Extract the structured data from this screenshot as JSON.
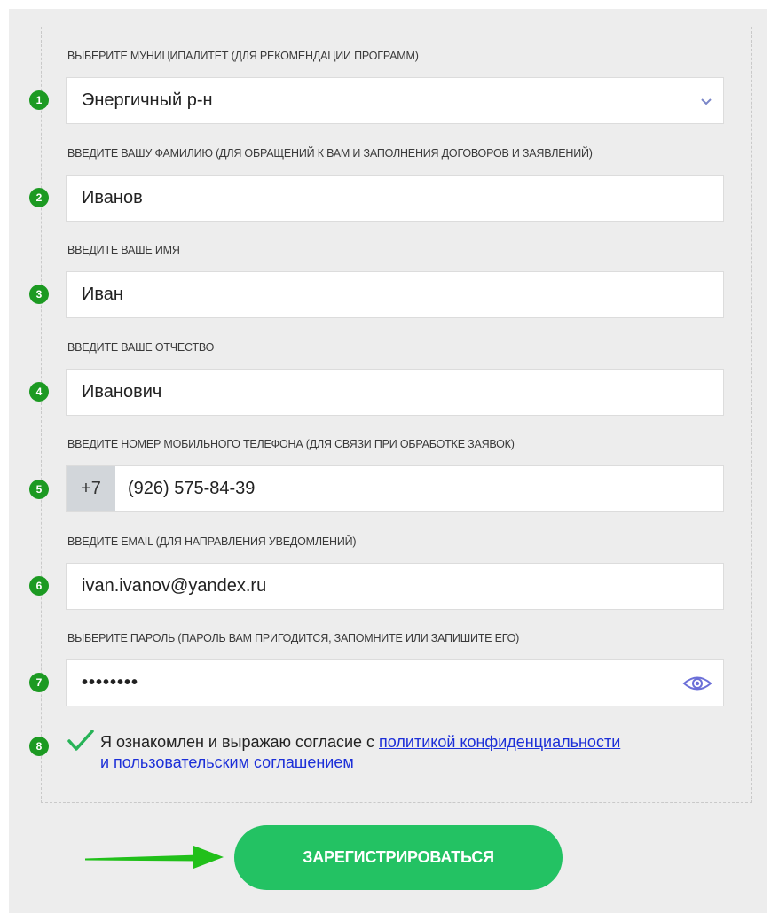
{
  "form": {
    "fields": [
      {
        "number": "1",
        "label": "ВЫБЕРИТЕ МУНИЦИПАЛИТЕТ (ДЛЯ РЕКОМЕНДАЦИИ ПРОГРАММ)",
        "value": "Энергичный р-н",
        "type": "select"
      },
      {
        "number": "2",
        "label": "ВВЕДИТЕ ВАШУ ФАМИЛИЮ (ДЛЯ ОБРАЩЕНИЙ К ВАМ И ЗАПОЛНЕНИЯ ДОГОВОРОВ И ЗАЯВЛЕНИЙ)",
        "value": "Иванов",
        "type": "text"
      },
      {
        "number": "3",
        "label": "ВВЕДИТЕ ВАШЕ ИМЯ",
        "value": "Иван",
        "type": "text"
      },
      {
        "number": "4",
        "label": "ВВЕДИТЕ ВАШЕ ОТЧЕСТВО",
        "value": "Иванович",
        "type": "text"
      },
      {
        "number": "5",
        "label": "ВВЕДИТЕ НОМЕР МОБИЛЬНОГО ТЕЛЕФОНА (ДЛЯ СВЯЗИ ПРИ ОБРАБОТКЕ ЗАЯВОК)",
        "prefix": "+7",
        "value": "(926) 575-84-39",
        "type": "phone"
      },
      {
        "number": "6",
        "label": "ВВЕДИТЕ EMAIL (ДЛЯ НАПРАВЛЕНИЯ УВЕДОМЛЕНИЙ)",
        "value": "ivan.ivanov@yandex.ru",
        "type": "email"
      },
      {
        "number": "7",
        "label": "ВЫБЕРИТЕ ПАРОЛЬ (ПАРОЛЬ ВАМ ПРИГОДИТСЯ, ЗАПОМНИТЕ ИЛИ ЗАПИШИТЕ ЕГО)",
        "value": "••••••••",
        "type": "password"
      }
    ],
    "consent": {
      "number": "8",
      "checked": true,
      "text": "Я ознакомлен и выражаю согласие с ",
      "link_line1": "политикой конфиденциальности",
      "link_line2": "и пользовательским соглашением"
    },
    "submit_label": "ЗАРЕГИСТРИРОВАТЬСЯ"
  },
  "icons": {
    "select": "chevron-down-icon",
    "password": "eye-icon",
    "checkbox": "checkmark-icon",
    "annotation": "arrow-right-icon"
  },
  "colors": {
    "number_badge": "#1c9a22",
    "submit_button": "#23c263",
    "arrow": "#21c01a",
    "link": "#1c2fd8",
    "eye_icon": "#6b6fd8",
    "checkmark": "#27b357"
  }
}
